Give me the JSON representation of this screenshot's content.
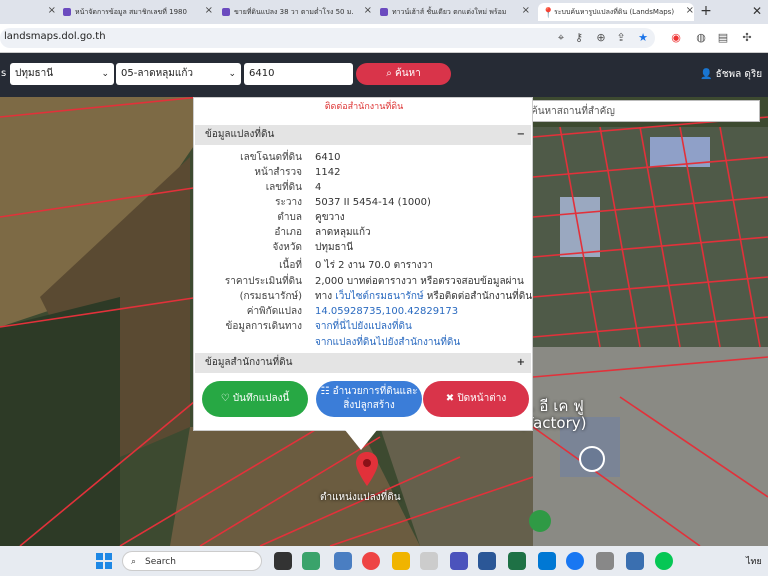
{
  "tabs": [
    {
      "label": "หน้าจัดการข้อมูล สมาชิกเลขที่ 1980"
    },
    {
      "label": "ขายที่ดินแปลง 38 วา ตามต่ำโรง 50 ม."
    },
    {
      "label": "ทาวน์เฮ้าส์ ชั้นเดียว ตกแต่งใหม่ พร้อม"
    },
    {
      "label": "ระบบค้นหารูปแปลงที่ดิน (LandsMaps)"
    }
  ],
  "address": {
    "url": "landsmaps.dol.go.th"
  },
  "nav": {
    "province": "ปทุมธานี",
    "district": "05-ลาดหลุมแก้ว",
    "parcel_no": "6410",
    "search_label": "ค้นหา",
    "user_name": "ธัชพล ดุริย",
    "place_search_placeholder": "ค้นหาสถานที่สำคัญ",
    "province_prefix": "s"
  },
  "popup": {
    "contact_text": "ติดต่อสำนักงานที่ดิน",
    "section_parcel": "ข้อมูลแปลงที่ดิน",
    "section_parcel_toggle": "−",
    "section_office": "ข้อมูลสำนักงานที่ดิน",
    "section_office_toggle": "+",
    "fields": [
      {
        "label": "เลขโฉนดที่ดิน",
        "value": "6410"
      },
      {
        "label": "หน้าสำรวจ",
        "value": "1142"
      },
      {
        "label": "เลขที่ดิน",
        "value": "4"
      },
      {
        "label": "ระวาง",
        "value": "5037 II 5454-14 (1000)"
      },
      {
        "label": "ตำบล",
        "value": "คูขวาง"
      },
      {
        "label": "อำเภอ",
        "value": "ลาดหลุมแก้ว"
      },
      {
        "label": "จังหวัด",
        "value": "ปทุมธานี"
      },
      {
        "label": "เนื้อที่",
        "value": "0 ไร่ 2 งาน 70.0 ตารางวา"
      }
    ],
    "price_label": "ราคาประเมินที่ดิน",
    "price_value": "2,000 บาทต่อตารางวา หรือตรวจสอบข้อมูลผ่าน",
    "price_label2": "(กรมธนารักษ์)",
    "price_value2_prefix": "ทาง",
    "price_link": "เว็บไซต์กรมธนารักษ์",
    "price_value2_suffix": "หรือติดต่อสำนักงานที่ดิน",
    "coord_label": "ค่าพิกัดแปลง",
    "coord_value": "14.05928735,100.42829173",
    "travel_label": "ข้อมูลการเดินทาง",
    "travel_link1": "จากที่นี่ไปยังแปลงที่ดิน",
    "travel_link2": "จากแปลงที่ดินไปยังสำนักงานที่ดิน",
    "btn_save": "♡ บันทึกแปลงนี้",
    "btn_info": "☷ อำนวยการที่ดินและสิ่งปลูกสร้าง",
    "btn_close": "✖ ปิดหน้าต่าง"
  },
  "map": {
    "factory_label": "ท. อี เค ฟู\n(Factory)",
    "pin_label": "ตำแหน่งแปลงที่ดิน",
    "boundary_color": "#e2313a"
  },
  "taskbar": {
    "search_label": "Search",
    "lang": "ไทย"
  }
}
